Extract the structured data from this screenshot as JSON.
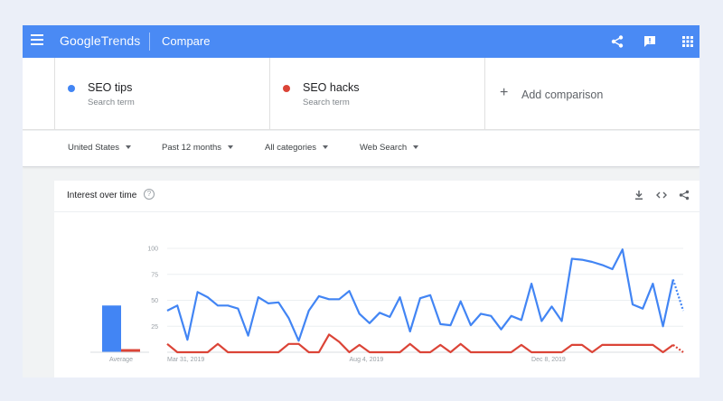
{
  "header": {
    "logo_word1": "Google",
    "logo_word2": "Trends",
    "title": "Compare",
    "icons": [
      "menu-icon",
      "share-icon",
      "feedback-icon",
      "apps-icon"
    ],
    "bg_color": "#4a8af4"
  },
  "compare": {
    "terms": [
      {
        "name": "SEO tips",
        "sub": "Search term",
        "color": "#4285f4"
      },
      {
        "name": "SEO hacks",
        "sub": "Search term",
        "color": "#db4437"
      }
    ],
    "add_label": "Add comparison"
  },
  "filters": {
    "region": "United States",
    "period": "Past 12 months",
    "category": "All categories",
    "search_type": "Web Search"
  },
  "card": {
    "title": "Interest over time",
    "help": "?",
    "icons": [
      "download-icon",
      "embed-icon",
      "share-icon"
    ]
  },
  "chart_data": {
    "type": "line",
    "ylim": [
      0,
      100
    ],
    "y_ticks": [
      "100",
      "75",
      "50",
      "25"
    ],
    "x_labels": [
      "Mar 31, 2019",
      "Aug 4, 2019",
      "Dec 8, 2019"
    ],
    "x_label_index": [
      0,
      18,
      36
    ],
    "average_label": "Average",
    "average": {
      "SEO tips": 45,
      "SEO hacks": 3
    },
    "partial_last_point": true,
    "series": [
      {
        "name": "SEO tips",
        "color": "#4285f4",
        "values": [
          40,
          45,
          12,
          58,
          53,
          45,
          45,
          42,
          16,
          53,
          47,
          48,
          33,
          11,
          40,
          54,
          51,
          51,
          59,
          37,
          28,
          38,
          34,
          53,
          20,
          52,
          55,
          27,
          26,
          49,
          26,
          37,
          35,
          22,
          35,
          31,
          66,
          30,
          44,
          30,
          90,
          89,
          87,
          84,
          80,
          99,
          46,
          42,
          66,
          25,
          70,
          40
        ]
      },
      {
        "name": "SEO hacks",
        "color": "#db4437",
        "values": [
          8,
          0,
          0,
          0,
          0,
          8,
          0,
          0,
          0,
          0,
          0,
          0,
          8,
          8,
          0,
          0,
          17,
          10,
          0,
          7,
          0,
          0,
          0,
          0,
          8,
          0,
          0,
          7,
          0,
          8,
          0,
          0,
          0,
          0,
          0,
          7,
          0,
          0,
          0,
          0,
          7,
          7,
          0,
          7,
          7,
          7,
          7,
          7,
          7,
          0,
          7,
          0
        ]
      }
    ]
  }
}
